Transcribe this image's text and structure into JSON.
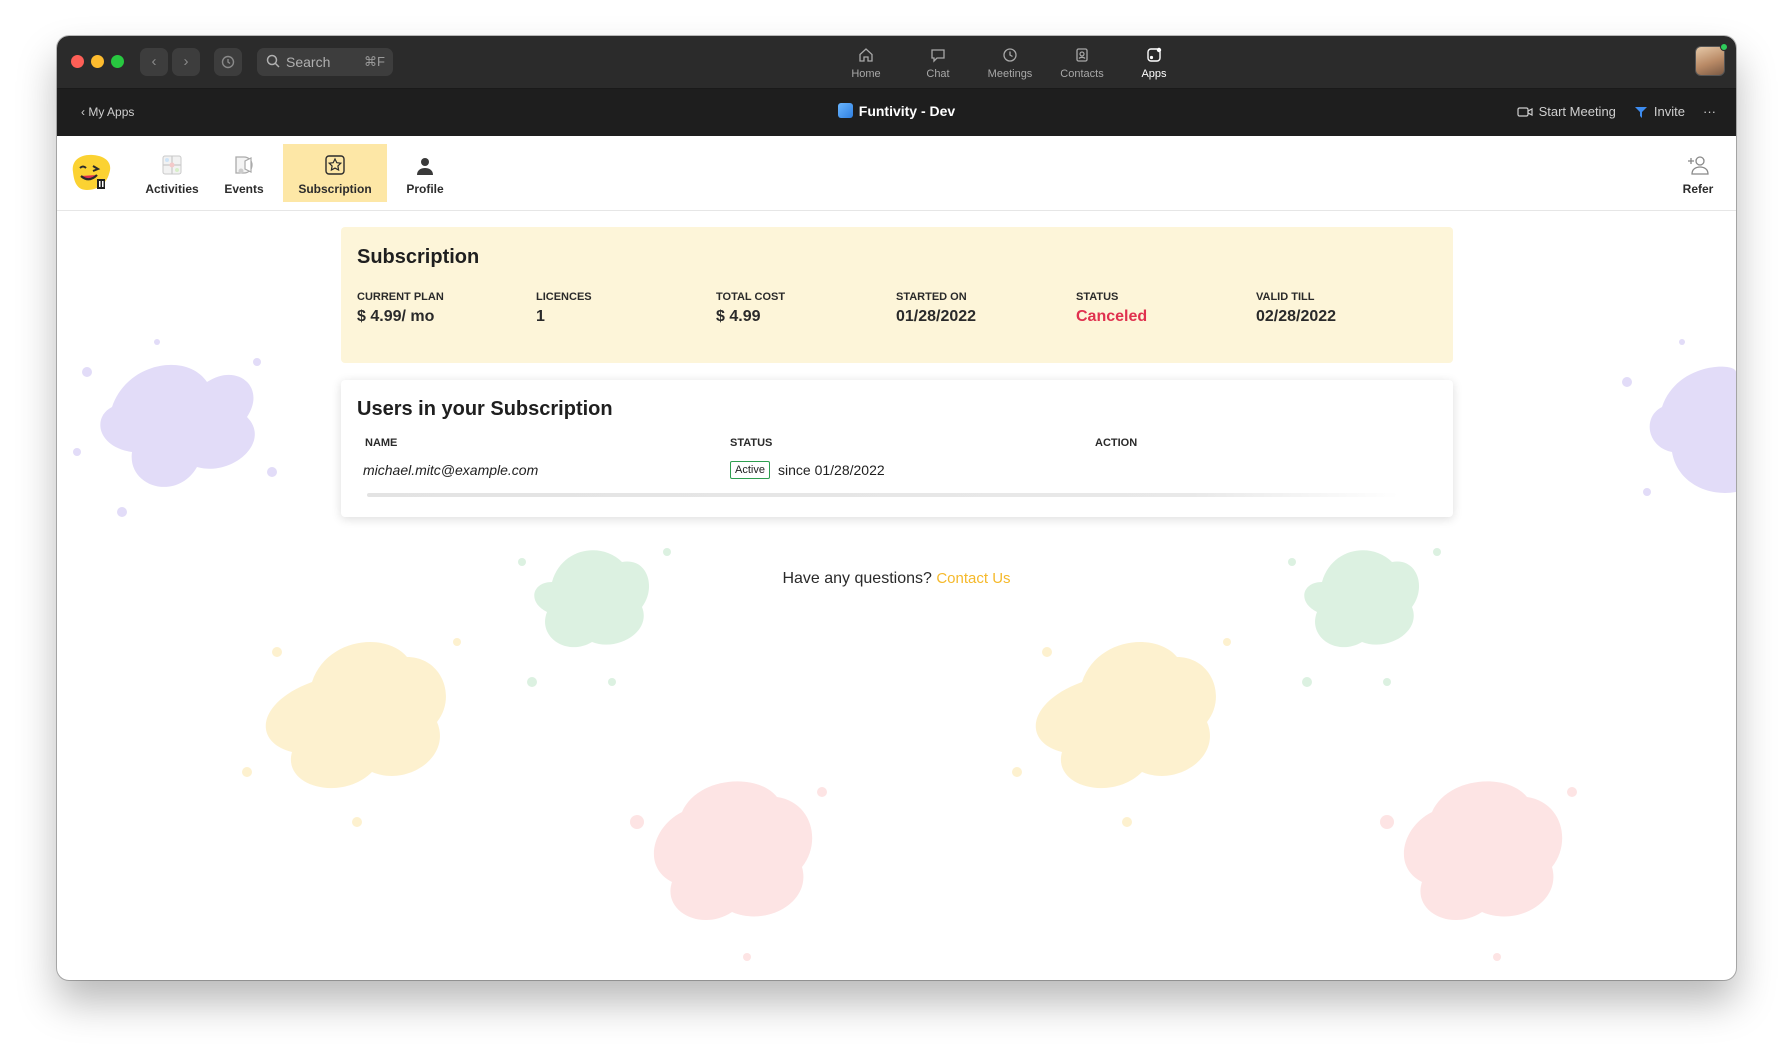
{
  "titlebar": {
    "search_label": "Search",
    "search_shortcut": "⌘F",
    "nav": [
      {
        "label": "Home",
        "icon": "home-icon"
      },
      {
        "label": "Chat",
        "icon": "chat-icon"
      },
      {
        "label": "Meetings",
        "icon": "clock-icon"
      },
      {
        "label": "Contacts",
        "icon": "contacts-icon"
      },
      {
        "label": "Apps",
        "icon": "apps-icon",
        "active": true
      }
    ]
  },
  "appbar": {
    "back_label": "My Apps",
    "title": "Funtivity - Dev",
    "start_meeting": "Start Meeting",
    "invite": "Invite",
    "more": "···"
  },
  "toolbar": {
    "items": [
      {
        "label": "Activities",
        "icon": "puzzle-icon"
      },
      {
        "label": "Events",
        "icon": "events-icon"
      },
      {
        "label": "Subscription",
        "icon": "star-icon",
        "active": true
      },
      {
        "label": "Profile",
        "icon": "person-icon"
      }
    ],
    "refer_label": "Refer"
  },
  "subscription": {
    "title": "Subscription",
    "fields": [
      {
        "label": "CURRENT PLAN",
        "value": "$ 4.99/ mo"
      },
      {
        "label": "LICENCES",
        "value": "1"
      },
      {
        "label": "TOTAL COST",
        "value": "$ 4.99"
      },
      {
        "label": "STARTED ON",
        "value": "01/28/2022"
      },
      {
        "label": "STATUS",
        "value": "Canceled"
      },
      {
        "label": "VALID TILL",
        "value": "02/28/2022"
      }
    ]
  },
  "users": {
    "title": "Users in your Subscription",
    "columns": [
      "NAME",
      "STATUS",
      "ACTION"
    ],
    "rows": [
      {
        "email": "michael.mitc@example.com",
        "status": "Active",
        "since": "since 01/28/2022"
      }
    ]
  },
  "footer": {
    "question": "Have any questions?",
    "contact_link": "Contact Us"
  },
  "colors": {
    "accent": "#fde7a6",
    "status_canceled": "#e0314f",
    "link": "#f5b92b",
    "badge_border": "#2e9e4f"
  }
}
